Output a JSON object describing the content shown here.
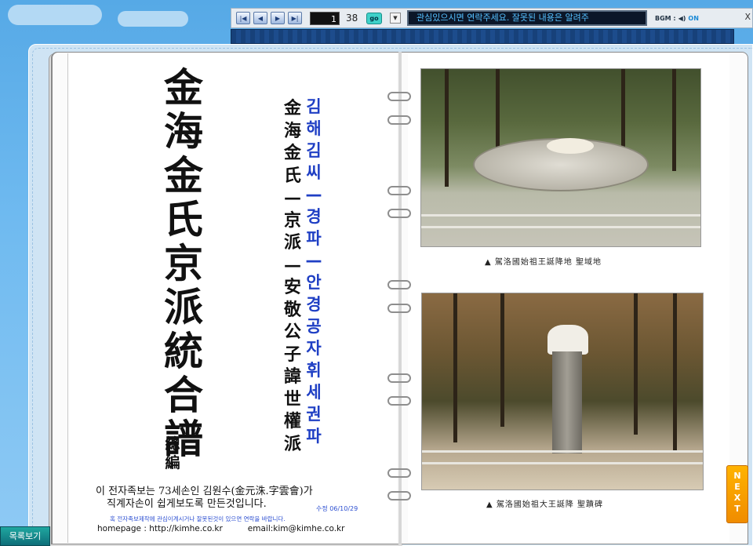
{
  "toolbar": {
    "first_icon": "first-page-icon",
    "prev_icon": "prev-page-icon",
    "next_icon": "next-page-icon",
    "last_icon": "last-page-icon",
    "current_page": "1",
    "total_pages": "38",
    "go_label": "go",
    "ticker_text": "관심있으시면 연락주세요.      잘못된 내용은 알려주",
    "bgm_label": "BGM :",
    "bgm_state": "ON",
    "close_label": "X"
  },
  "left_page": {
    "title_hanja": "金海金氏京派統合譜",
    "subtitle": "總編",
    "hanja_column": "金海金氏—京派—安敬公子諱世權派",
    "korean_column": "김해김씨—경파—안경공자휘세권파",
    "credit_line1": "이 전자족보는 73세손인 김원수(金元洙.字雲會)가",
    "credit_line2": "직계자손이 쉽게보도록 만든것입니다.",
    "date": "수정 06/10/29",
    "notice": "혹 전자족보제작에 관심이계시거나 잘못된것이 있으면 연락을 바랍니다.",
    "homepage": "homepage : http://kimhe.co.kr",
    "email": "email:kim@kimhe.co.kr"
  },
  "right_page": {
    "caption1": "▲ 駕洛國始祖王誕降地  聖域地",
    "caption2": "▲ 駕洛國始祖大王誕降  聖蹟碑"
  },
  "controls": {
    "next_label": "NEXT",
    "list_label": "목록보기"
  }
}
